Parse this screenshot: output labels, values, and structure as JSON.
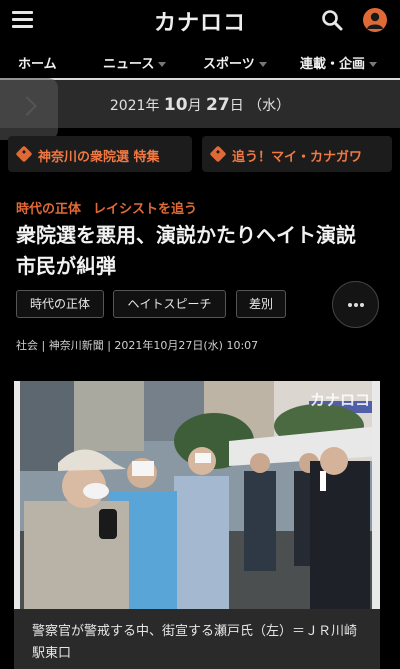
{
  "header": {
    "logo": "カナロコ",
    "menu_icon": "hamburger-icon",
    "search_icon": "search-icon",
    "account_icon": "account-icon",
    "accent_color": "#e06a36"
  },
  "nav": {
    "items": [
      {
        "label": "ホーム",
        "dropdown": false
      },
      {
        "label": "ニュース",
        "dropdown": true
      },
      {
        "label": "スポーツ",
        "dropdown": true
      },
      {
        "label": "連載・企画",
        "dropdown": true
      }
    ]
  },
  "datebar": {
    "year": "2021",
    "year_unit": "年",
    "month": "10",
    "month_unit": "月",
    "day": "27",
    "day_unit": "日",
    "weekday": "（水）"
  },
  "features": [
    {
      "label": "神奈川の衆院選 特集",
      "icon": "tag-icon"
    },
    {
      "label": "追う！マイ・カナガワ",
      "icon": "tag-icon"
    }
  ],
  "article": {
    "categories": [
      "時代の正体",
      "レイシストを追う"
    ],
    "title": "衆院選を悪用、演説かたりヘイト演説　市民が糾弾",
    "tags": [
      "時代の正体",
      "ヘイトスピーチ",
      "差別"
    ],
    "meta": "社会 | 神奈川新聞 | 2021年10月27日(水) 10:07",
    "photo_watermark": "カナロコ",
    "caption": "警察官が警戒する中、街宣する瀬戸氏（左）＝ＪＲ川崎駅東口"
  }
}
